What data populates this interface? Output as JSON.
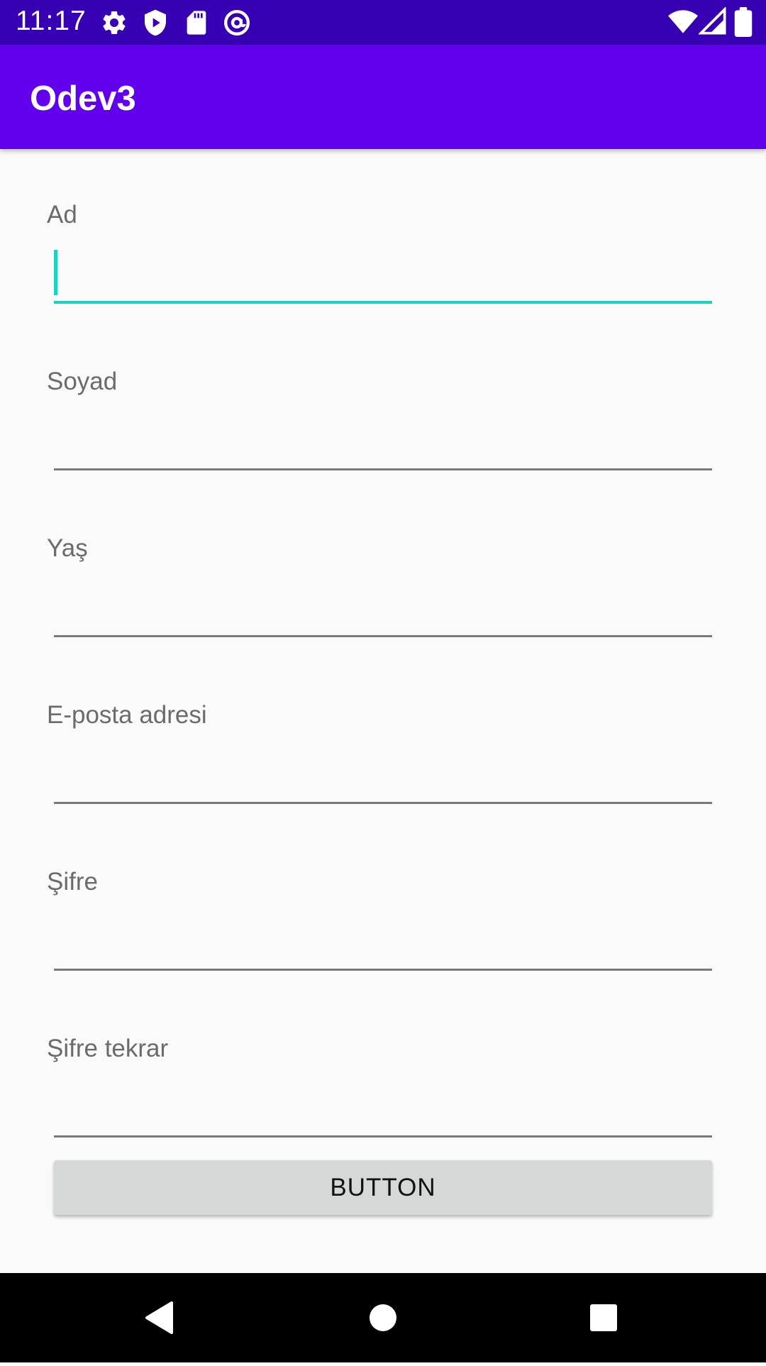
{
  "status_bar": {
    "time": "11:17",
    "icons": [
      "gear-icon",
      "shield-play-icon",
      "sd-card-icon",
      "at-sign-icon",
      "wifi-icon",
      "signal-icon",
      "battery-icon"
    ],
    "background": "#3700b3"
  },
  "app_bar": {
    "title": "Odev3",
    "background": "#6200ee"
  },
  "form": {
    "fields": [
      {
        "label": "Ad",
        "value": ""
      },
      {
        "label": "Soyad",
        "value": ""
      },
      {
        "label": "Yaş",
        "value": ""
      },
      {
        "label": "E-posta adresi",
        "value": ""
      },
      {
        "label": "Şifre",
        "value": ""
      },
      {
        "label": "Şifre tekrar",
        "value": ""
      }
    ],
    "focus_color": "#1ad1c2",
    "button_label": "BUTTON"
  },
  "nav_bar": {
    "icons": [
      "back-icon",
      "home-icon",
      "recents-icon"
    ]
  }
}
